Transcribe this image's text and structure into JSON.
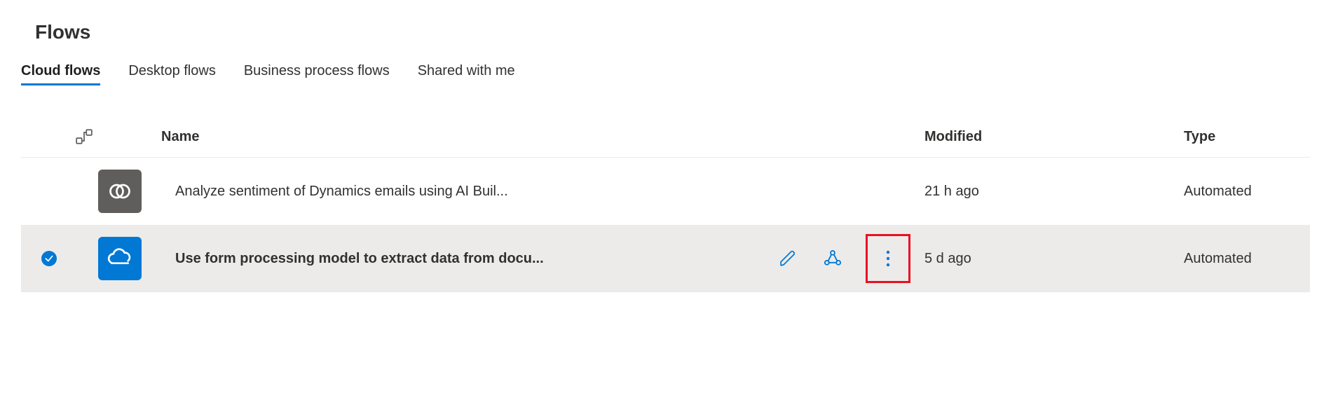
{
  "page": {
    "title": "Flows"
  },
  "tabs": [
    {
      "label": "Cloud flows",
      "active": true
    },
    {
      "label": "Desktop flows",
      "active": false
    },
    {
      "label": "Business process flows",
      "active": false
    },
    {
      "label": "Shared with me",
      "active": false
    }
  ],
  "columns": {
    "name": "Name",
    "modified": "Modified",
    "type": "Type"
  },
  "rows": [
    {
      "selected": false,
      "icon": "dynamics-icon",
      "icon_bg": "gray",
      "name": "Analyze sentiment of Dynamics emails using AI Buil...",
      "modified": "21 h ago",
      "type": "Automated",
      "show_actions": false
    },
    {
      "selected": true,
      "icon": "onedrive-icon",
      "icon_bg": "blue",
      "name": "Use form processing model to extract data from docu...",
      "modified": "5 d ago",
      "type": "Automated",
      "show_actions": true
    }
  ]
}
